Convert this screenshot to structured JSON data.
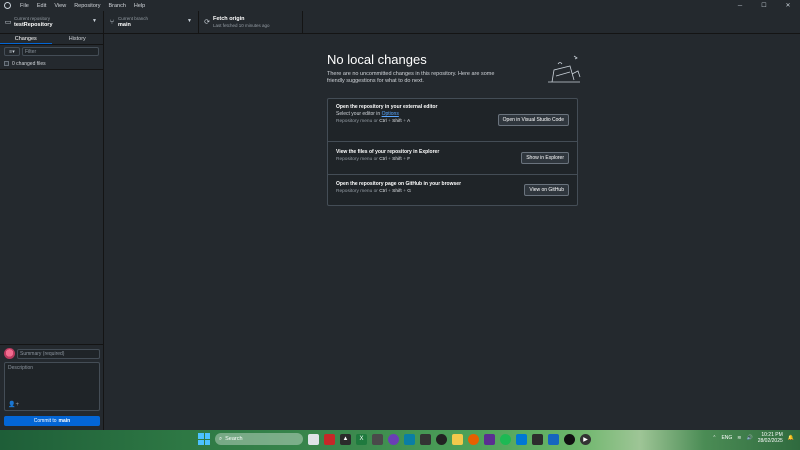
{
  "menu": [
    "File",
    "Edit",
    "View",
    "Repository",
    "Branch",
    "Help"
  ],
  "window_controls": {
    "minimize": "─",
    "maximize": "☐",
    "close": "✕"
  },
  "toolbar": {
    "repo": {
      "sub": "Current repository",
      "main": "testRepository"
    },
    "branch": {
      "sub": "Current branch",
      "main": "main"
    },
    "fetch": {
      "main": "Fetch origin",
      "sub": "Last fetched 10 minutes ago"
    }
  },
  "sidebar": {
    "tabs": [
      "Changes",
      "History"
    ],
    "filter_placeholder": "Filter",
    "changed_files": "0 changed files"
  },
  "commit": {
    "summary_placeholder": "Summary (required)",
    "description_placeholder": "Description",
    "button_prefix": "Commit to",
    "button_branch": "main"
  },
  "main": {
    "title": "No local changes",
    "description": "There are no uncommitted changes in this repository. Here are some friendly suggestions for what to do next.",
    "suggestions": [
      {
        "title": "Open the repository in your external editor",
        "line2_prefix": "Select your editor in",
        "line2_link": "Options",
        "shortcut_prefix": "Repository menu or",
        "keys": [
          "Ctrl",
          "Shift",
          "A"
        ],
        "button": "Open in Visual Studio Code"
      },
      {
        "title": "View the files of your repository in Explorer",
        "shortcut_prefix": "Repository menu or",
        "keys": [
          "Ctrl",
          "Shift",
          "F"
        ],
        "button": "Show in Explorer"
      },
      {
        "title": "Open the repository page on GitHub in your browser",
        "shortcut_prefix": "Repository menu or",
        "keys": [
          "Ctrl",
          "Shift",
          "G"
        ],
        "button": "View on GitHub"
      }
    ]
  },
  "taskbar": {
    "search": "Search",
    "language": "ENG",
    "time": "10:21 PM",
    "date": "28/02/2025"
  }
}
